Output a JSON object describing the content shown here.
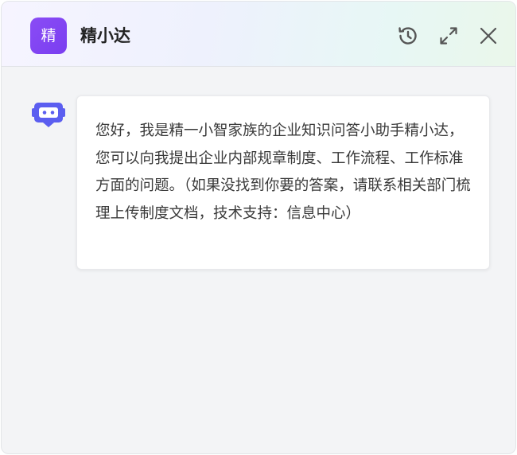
{
  "header": {
    "logo_char": "精",
    "title": "精小达",
    "icons": {
      "history": "history-icon",
      "expand": "expand-icon",
      "close": "close-icon"
    }
  },
  "chat": {
    "bot_avatar_icon": "robot-icon",
    "messages": [
      {
        "role": "assistant",
        "text": "您好，我是精一小智家族的企业知识问答小助手精小达，您可以向我提出企业内部规章制度、工作流程、工作标准方面的问题。（如果没找到你要的答案，请联系相关部门梳理上传制度文档，技术支持：信息中心）"
      }
    ]
  },
  "colors": {
    "accent": "#7c3aed",
    "bot_avatar": "#5b5ef0",
    "icon_gray": "#555555"
  }
}
